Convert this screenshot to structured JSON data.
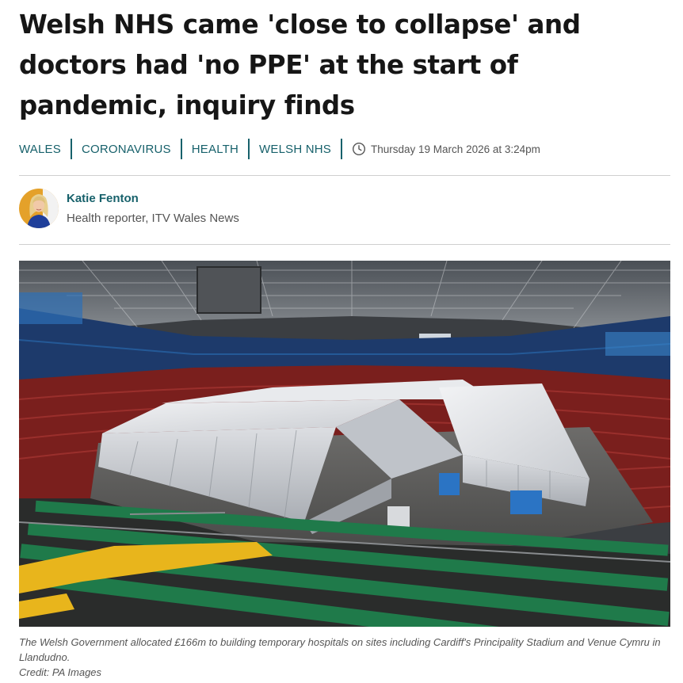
{
  "article": {
    "headline": "Welsh NHS came 'close to collapse' and doctors had 'no PPE' at the start of pandemic, inquiry finds",
    "tags": [
      "WALES",
      "CORONAVIRUS",
      "HEALTH",
      "WELSH NHS"
    ],
    "timestamp": "Thursday 19 March 2026 at 3:24pm",
    "timestamp_icon": "clock-icon"
  },
  "author": {
    "name": "Katie Fenton",
    "role": "Health reporter, ITV Wales News",
    "avatar_icon": "author-avatar"
  },
  "hero": {
    "caption": "The Welsh Government allocated £166m to building temporary hospitals on sites including Cardiff's Principality Stadium and Venue Cymru in Llandudno.",
    "credit": "Credit: PA Images"
  },
  "colors": {
    "accent": "#17616b",
    "text": "#161616",
    "muted": "#555555",
    "rule": "#cfcfcf"
  }
}
